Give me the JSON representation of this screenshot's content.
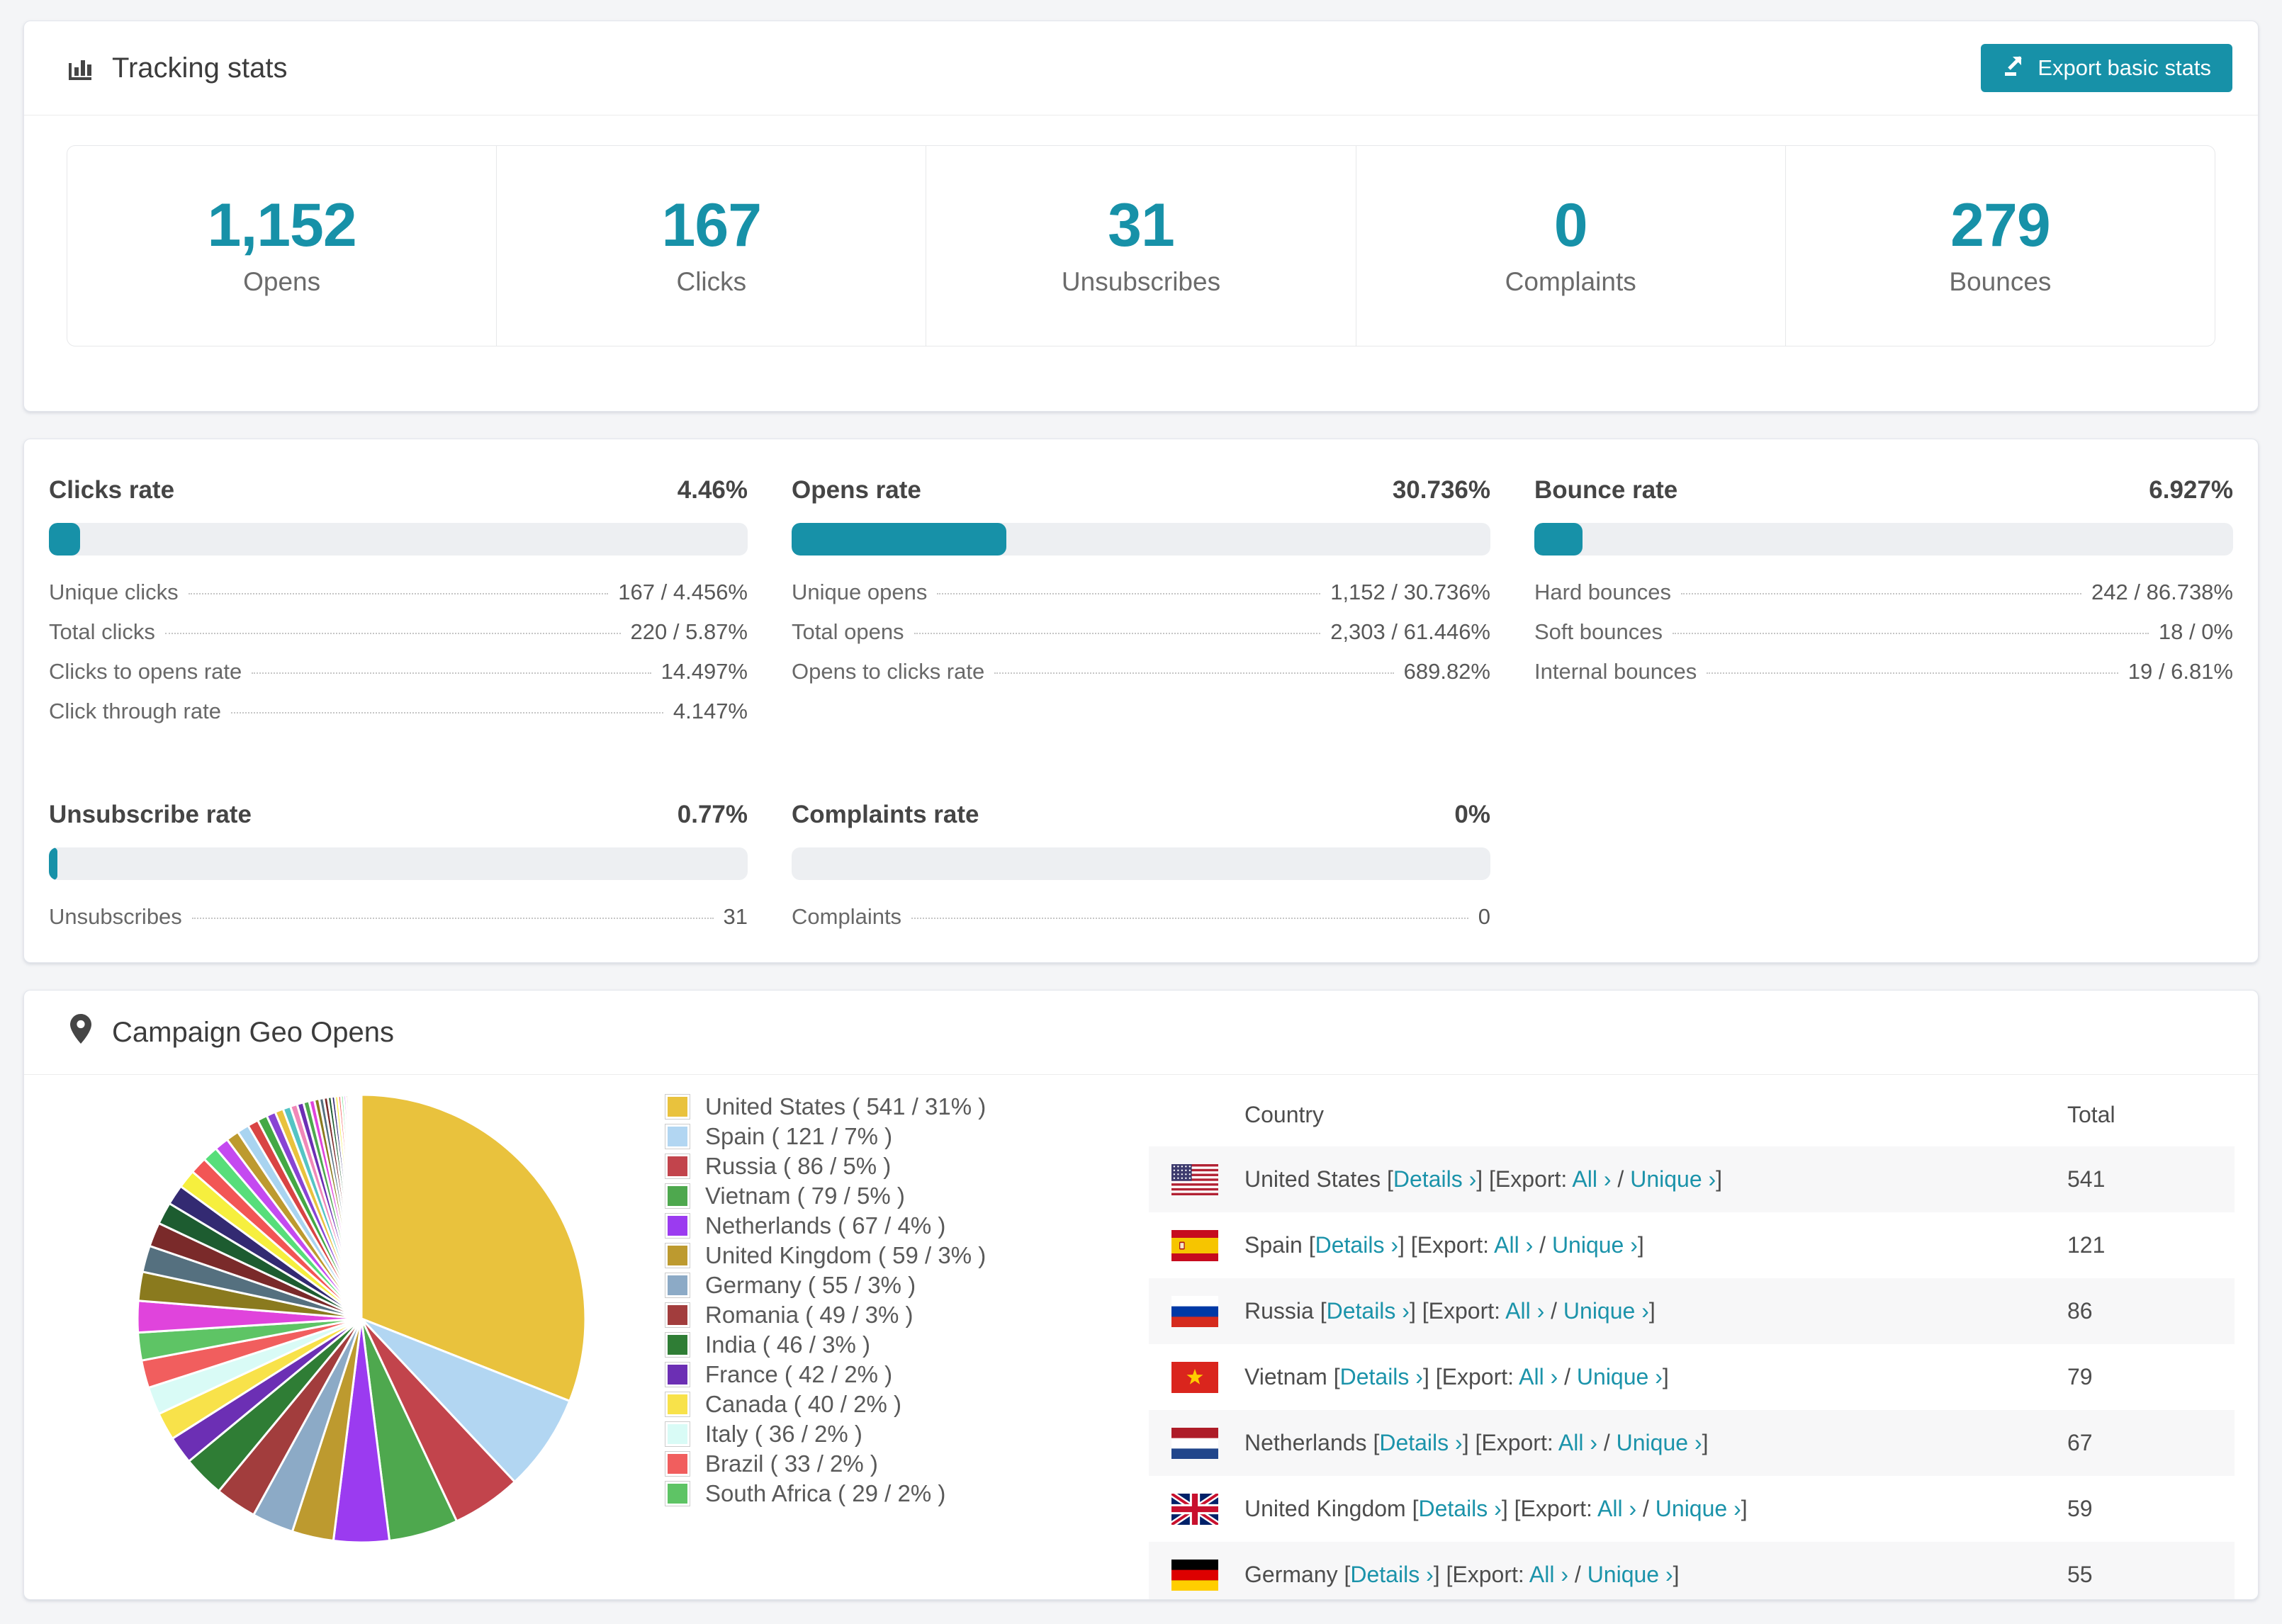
{
  "theme": {
    "accent": "#1791a8",
    "link": "#1b93aa"
  },
  "tracking": {
    "icon": "bar-chart-icon",
    "title": "Tracking stats",
    "export_button": {
      "icon": "export-icon",
      "label": "Export basic stats"
    },
    "stats": [
      {
        "value": "1,152",
        "label": "Opens"
      },
      {
        "value": "167",
        "label": "Clicks"
      },
      {
        "value": "31",
        "label": "Unsubscribes"
      },
      {
        "value": "0",
        "label": "Complaints"
      },
      {
        "value": "279",
        "label": "Bounces"
      }
    ]
  },
  "rates": {
    "blocks": [
      {
        "title": "Clicks rate",
        "value": "4.46%",
        "pct": 4.46,
        "rows": [
          {
            "label": "Unique clicks",
            "value": "167 / 4.456%"
          },
          {
            "label": "Total clicks",
            "value": "220 / 5.87%"
          },
          {
            "label": "Clicks to opens rate",
            "value": "14.497%"
          },
          {
            "label": "Click through rate",
            "value": "4.147%"
          }
        ]
      },
      {
        "title": "Opens rate",
        "value": "30.736%",
        "pct": 30.736,
        "rows": [
          {
            "label": "Unique opens",
            "value": "1,152 / 30.736%"
          },
          {
            "label": "Total opens",
            "value": "2,303 / 61.446%"
          },
          {
            "label": "Opens to clicks rate",
            "value": "689.82%"
          }
        ]
      },
      {
        "title": "Bounce rate",
        "value": "6.927%",
        "pct": 6.927,
        "rows": [
          {
            "label": "Hard bounces",
            "value": "242 / 86.738%"
          },
          {
            "label": "Soft bounces",
            "value": "18 / 0%"
          },
          {
            "label": "Internal bounces",
            "value": "19 / 6.81%"
          }
        ]
      },
      {
        "title": "Unsubscribe rate",
        "value": "0.77%",
        "pct": 0.77,
        "rows": [
          {
            "label": "Unsubscribes",
            "value": "31"
          }
        ]
      },
      {
        "title": "Complaints rate",
        "value": "0%",
        "pct": 0,
        "rows": [
          {
            "label": "Complaints",
            "value": "0"
          }
        ]
      }
    ]
  },
  "geo": {
    "icon": "map-pin-icon",
    "title": "Campaign Geo Opens",
    "table": {
      "columns": [
        "Country",
        "Total"
      ],
      "link_labels": {
        "bracket_open": "[",
        "bracket_close": "]",
        "details": "Details ›",
        "export_prefix": "[Export:",
        "all": "All ›",
        "slash": "/",
        "unique": "Unique ›"
      },
      "rows": [
        {
          "country": "United States",
          "flag": "us-flag-icon",
          "total": "541"
        },
        {
          "country": "Spain",
          "flag": "es-flag-icon",
          "total": "121"
        },
        {
          "country": "Russia",
          "flag": "ru-flag-icon",
          "total": "86"
        },
        {
          "country": "Vietnam",
          "flag": "vn-flag-icon",
          "total": "79"
        },
        {
          "country": "Netherlands",
          "flag": "nl-flag-icon",
          "total": "67"
        },
        {
          "country": "United Kingdom",
          "flag": "gb-flag-icon",
          "total": "59"
        },
        {
          "country": "Germany",
          "flag": "de-flag-icon",
          "total": "55"
        }
      ]
    }
  },
  "chart_data": {
    "type": "pie",
    "title": "Campaign Geo Opens",
    "legend_position": "right",
    "start_angle_deg": 0,
    "direction": "clockwise",
    "legend_format": "{label} ( {value} / {pct}% )",
    "slices": [
      {
        "label": "United States",
        "value": 541,
        "pct": 31,
        "color": "#e9c23d"
      },
      {
        "label": "Spain",
        "value": 121,
        "pct": 7,
        "color": "#b2d6f2"
      },
      {
        "label": "Russia",
        "value": 86,
        "pct": 5,
        "color": "#c2444c"
      },
      {
        "label": "Vietnam",
        "value": 79,
        "pct": 5,
        "color": "#4ea84e"
      },
      {
        "label": "Netherlands",
        "value": 67,
        "pct": 4,
        "color": "#9b3bf0"
      },
      {
        "label": "United Kingdom",
        "value": 59,
        "pct": 3,
        "color": "#bd9a2f"
      },
      {
        "label": "Germany",
        "value": 55,
        "pct": 3,
        "color": "#8caac6"
      },
      {
        "label": "Romania",
        "value": 49,
        "pct": 3,
        "color": "#a23d3d"
      },
      {
        "label": "India",
        "value": 46,
        "pct": 3,
        "color": "#2f7d35"
      },
      {
        "label": "France",
        "value": 42,
        "pct": 2,
        "color": "#6c2fb4"
      },
      {
        "label": "Canada",
        "value": 40,
        "pct": 2,
        "color": "#f8e24a"
      },
      {
        "label": "Italy",
        "value": 36,
        "pct": 2,
        "color": "#d9fbf6"
      },
      {
        "label": "Brazil",
        "value": 33,
        "pct": 2,
        "color": "#f15e5e"
      },
      {
        "label": "South Africa",
        "value": 29,
        "pct": 2,
        "color": "#5ec465"
      }
    ],
    "others_total_pct": 26
  }
}
